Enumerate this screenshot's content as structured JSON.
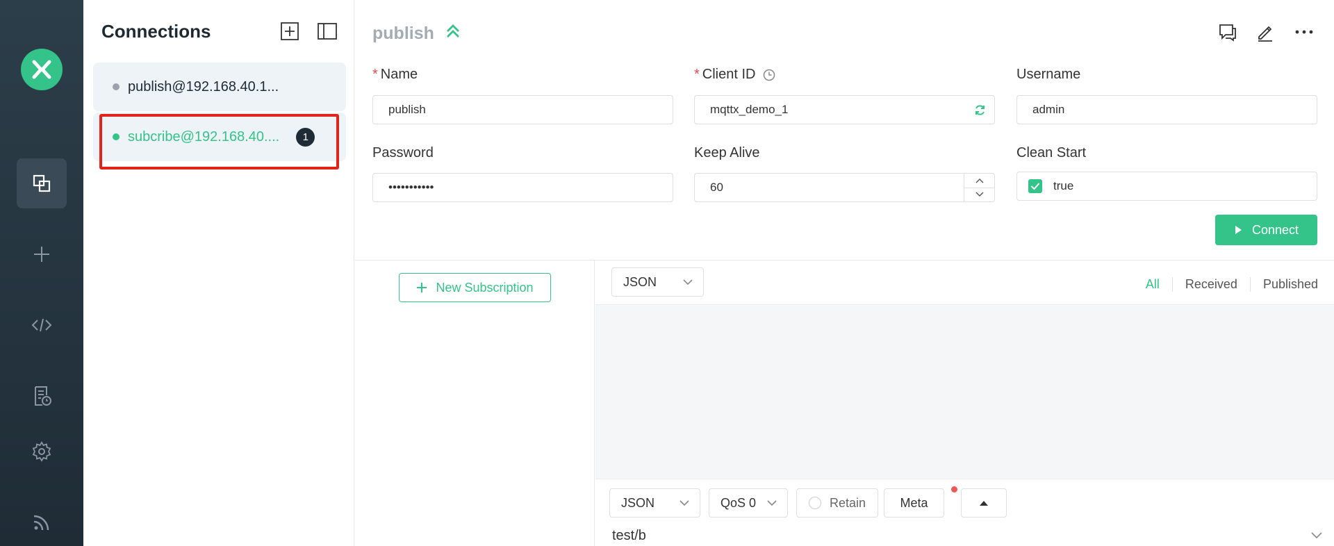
{
  "sidebar": {
    "nav": [
      {
        "icon": "connections-icon",
        "active": true
      },
      {
        "icon": "plus-icon"
      },
      {
        "icon": "code-icon"
      },
      {
        "icon": "log-icon"
      },
      {
        "icon": "gear-icon"
      },
      {
        "icon": "rss-icon"
      }
    ]
  },
  "connections": {
    "title": "Connections",
    "items": [
      {
        "label": "publish@192.168.40.1...",
        "status": "offline"
      },
      {
        "label": "subcribe@192.168.40....",
        "status": "online",
        "badge": "1"
      }
    ]
  },
  "main": {
    "title": "publish",
    "fields": {
      "name_label": "Name",
      "name_value": "publish",
      "client_id_label": "Client ID",
      "client_id_value": "mqttx_demo_1",
      "username_label": "Username",
      "username_value": "admin",
      "password_label": "Password",
      "password_value": "•••••••••••",
      "keep_alive_label": "Keep Alive",
      "keep_alive_value": "60",
      "clean_start_label": "Clean Start",
      "clean_start_value": "true"
    },
    "connect_label": "Connect",
    "new_subscription_label": "New Subscription",
    "payload_format": "JSON",
    "filters": [
      "All",
      "Received",
      "Published"
    ],
    "publish": {
      "format": "JSON",
      "qos": "QoS 0",
      "retain_label": "Retain",
      "meta_label": "Meta",
      "topic": "test/b"
    }
  },
  "colors": {
    "accent": "#34c388",
    "rail": "#263540",
    "highlight": "#e2231a"
  }
}
